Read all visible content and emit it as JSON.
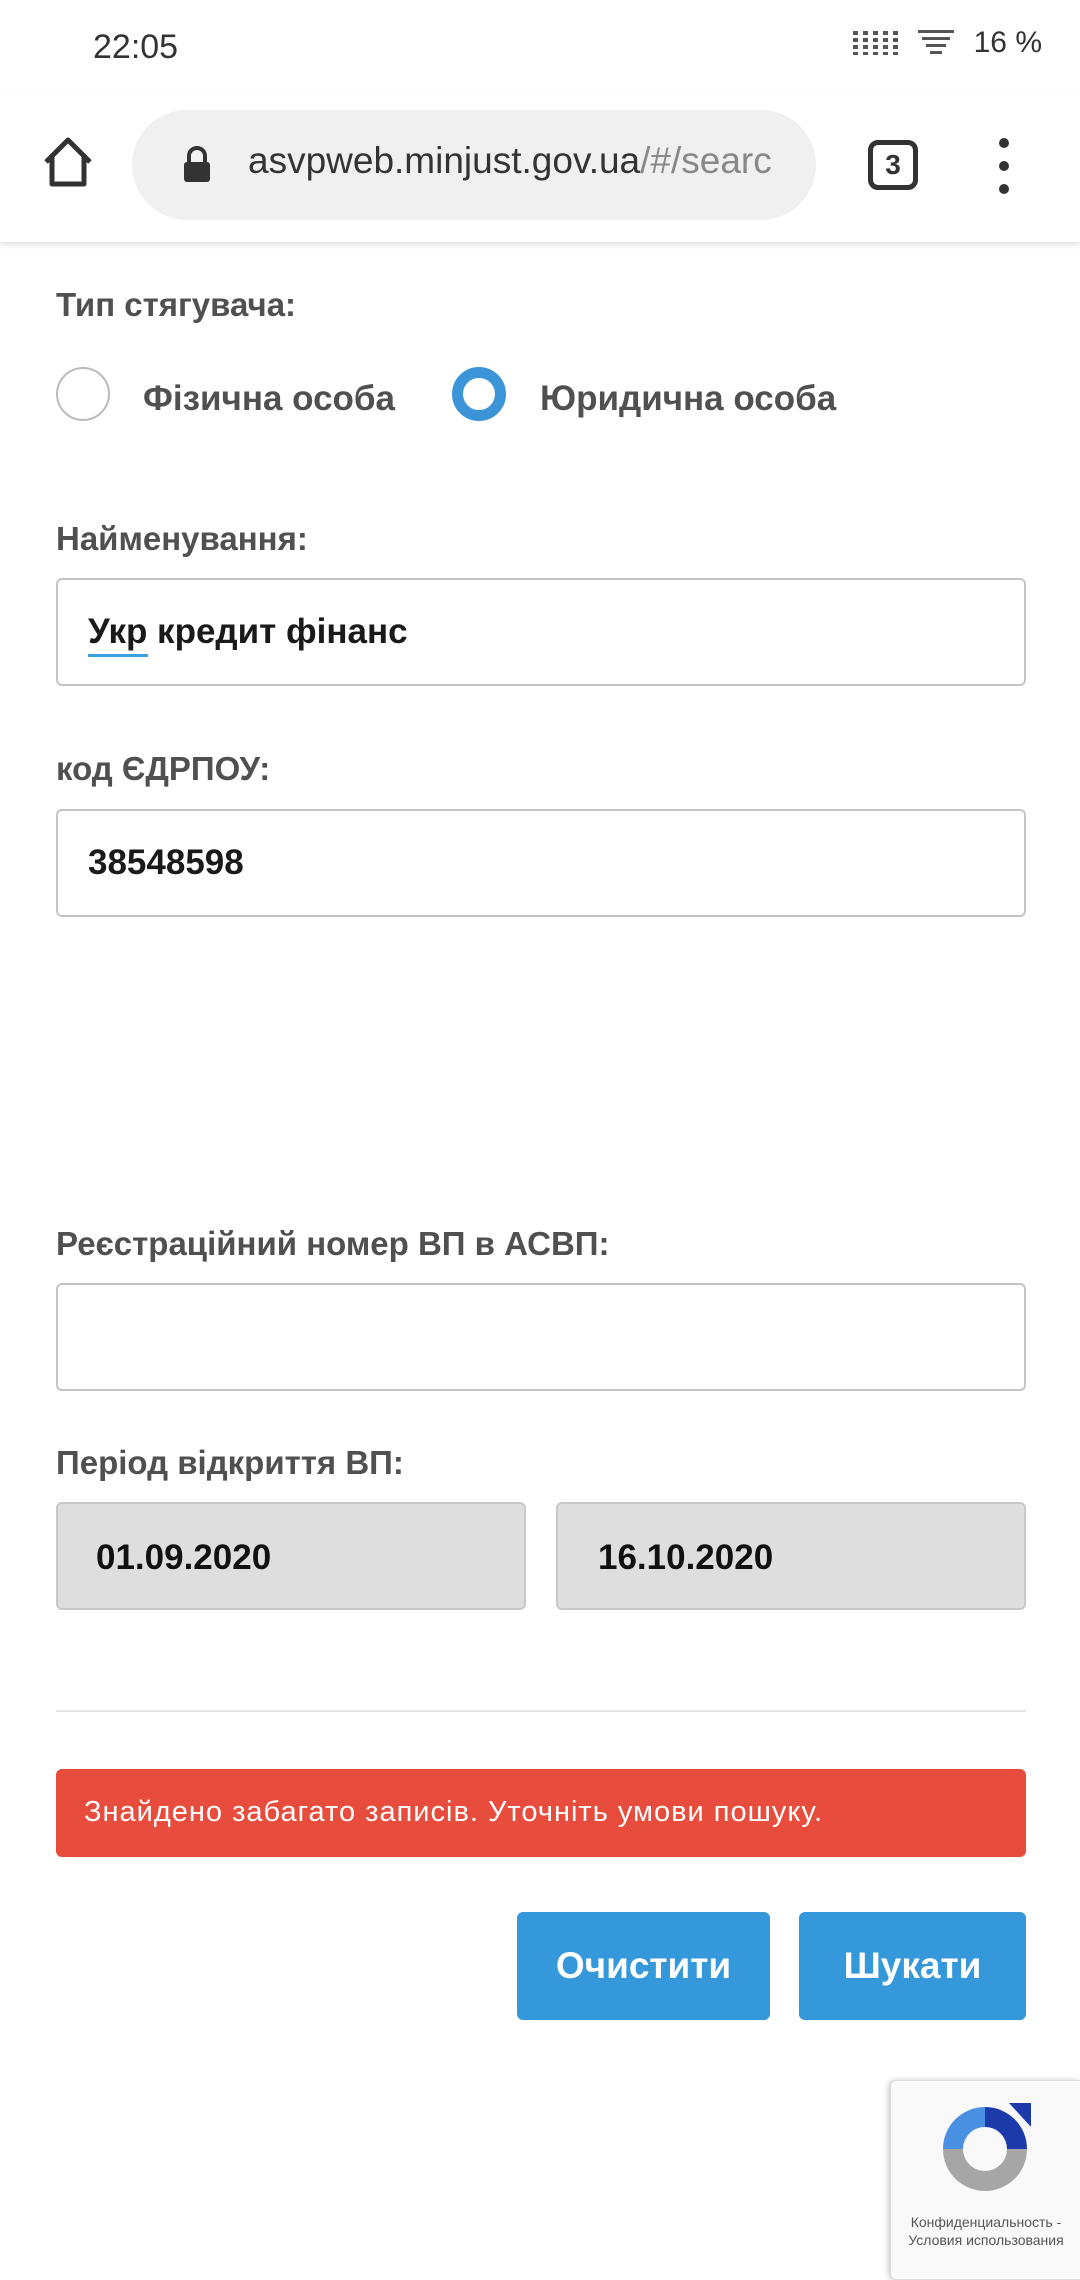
{
  "status_bar": {
    "time": "22:05",
    "battery": "16 %"
  },
  "browser": {
    "url_host": "asvpweb.minjust.gov.ua",
    "url_path": "/#/searc",
    "tab_count": "3"
  },
  "form": {
    "collector_type_label": "Тип стягувача:",
    "radio_individual": "Фізична особа",
    "radio_legal": "Юридична особа",
    "selected_type": "Юридична особа",
    "name_label": "Найменування:",
    "name_value": "Укр кредит фінанс",
    "edrpou_label": "код ЄДРПОУ:",
    "edrpou_value": "38548598",
    "reg_number_label": "Реєстраційний номер ВП в АСВП:",
    "reg_number_value": "",
    "period_label": "Період відкриття ВП:",
    "date_from": "01.09.2020",
    "date_to": "16.10.2020"
  },
  "alert": {
    "text": "Знайдено забагато записів. Уточніть умови пошуку.",
    "color": "#e74c3c"
  },
  "buttons": {
    "clear": "Очистити",
    "search": "Шукати",
    "color": "#3498db"
  },
  "recaptcha": {
    "privacy": "Конфиденциальность -",
    "terms": "Условия использования"
  }
}
